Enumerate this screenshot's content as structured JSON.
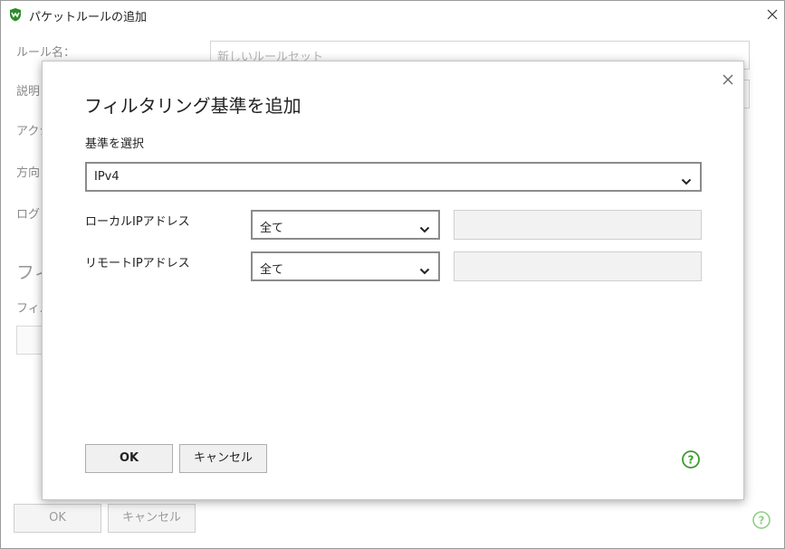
{
  "window": {
    "title": "パケットルールの追加"
  },
  "background_form": {
    "rule_name_label": "ルール名：",
    "rule_name_placeholder": "新しいルールセット",
    "description_label": "説明",
    "action_label": "アクシ",
    "direction_label": "方向",
    "log_label": "ログ：",
    "filter_heading": "フィ",
    "filter_sub_label": "フィル",
    "ok_label": "OK",
    "cancel_label": "キャンセル"
  },
  "dialog": {
    "title": "フィルタリング基準を追加",
    "criteria_label": "基準を選択",
    "criteria_value": "IPv4",
    "local_ip_label": "ローカルIPアドレス",
    "local_ip_value": "全て",
    "remote_ip_label": "リモートIPアドレス",
    "remote_ip_value": "全て",
    "ok_label": "OK",
    "cancel_label": "キャンセル"
  },
  "icons": {
    "app": "app-logo-icon",
    "window_close": "close-icon",
    "dialog_close": "close-icon",
    "help": "help-icon",
    "dropdown": "chevron-down-icon"
  },
  "colors": {
    "help_green": "#3a9c2a",
    "select_border": "#8b8b8b",
    "disabled_fill": "#f2f2f2"
  }
}
